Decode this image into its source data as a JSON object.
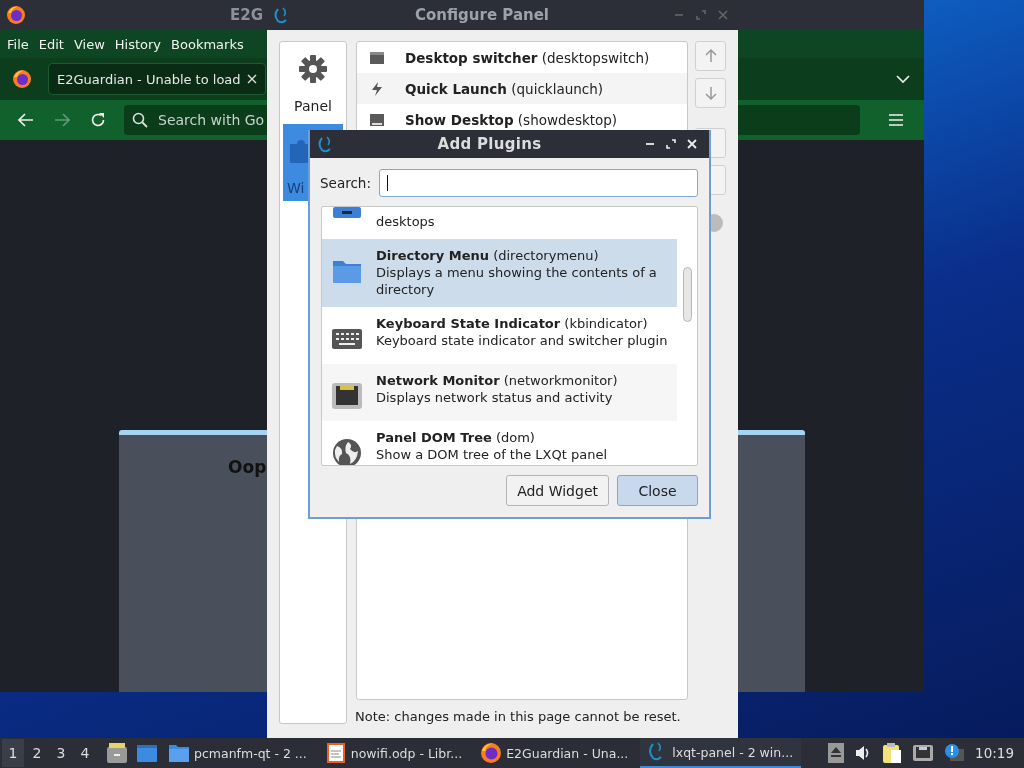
{
  "browser_window": {
    "title": "E2G",
    "menu": [
      "File",
      "Edit",
      "View",
      "History",
      "Bookmarks"
    ],
    "tab": {
      "title": "E2Guardian - Unable to load"
    },
    "search": {
      "placeholder": "Search with Go"
    },
    "page_heading": "Oop"
  },
  "configure_window": {
    "title": "Configure Panel",
    "sidebar": [
      {
        "label": "Panel",
        "selected": false
      },
      {
        "label": "Wi",
        "selected": true
      }
    ],
    "widgets": [
      {
        "name": "**Desktop switcher** (desktopswitch)"
      },
      {
        "name": "**Quick Launch** (quicklaunch)"
      },
      {
        "name": "**Show Desktop** (showdesktop)"
      }
    ],
    "note": "Note: changes made in this page cannot be reset."
  },
  "dialog": {
    "title": "Add Plugins",
    "search_label": "Search:",
    "plugins": [
      {
        "description": "desktops",
        "selected": false
      },
      {
        "name": "**Directory Menu** (directorymenu)",
        "description": "Displays a menu showing the contents of a directory",
        "selected": true
      },
      {
        "name": "**Keyboard State Indicator** (kbindicator)",
        "description": "Keyboard state indicator and switcher plugin",
        "selected": false
      },
      {
        "name": "**Network Monitor** (networkmonitor)",
        "description": "Displays network status and activity",
        "selected": false
      },
      {
        "name": "**Panel DOM Tree** (dom)",
        "description": "Show a DOM tree of the LXQt panel",
        "selected": false
      }
    ],
    "buttons": [
      {
        "label": "Add Widget",
        "default": false
      },
      {
        "label": "Close",
        "default": true
      }
    ]
  },
  "taskbar": {
    "desktops": [
      {
        "label": "1",
        "selected": true
      },
      {
        "label": "2",
        "selected": false
      },
      {
        "label": "3",
        "selected": false
      },
      {
        "label": "4",
        "selected": false
      }
    ],
    "tasks": [
      {
        "label": "pcmanfm-qt - 2 ...",
        "selected": false
      },
      {
        "label": "nowifi.odp - Libr...",
        "selected": false
      },
      {
        "label": "E2Guardian - Una...",
        "selected": false
      },
      {
        "label": "lxqt-panel - 2 win...",
        "selected": true
      }
    ],
    "clock": "10:19"
  }
}
